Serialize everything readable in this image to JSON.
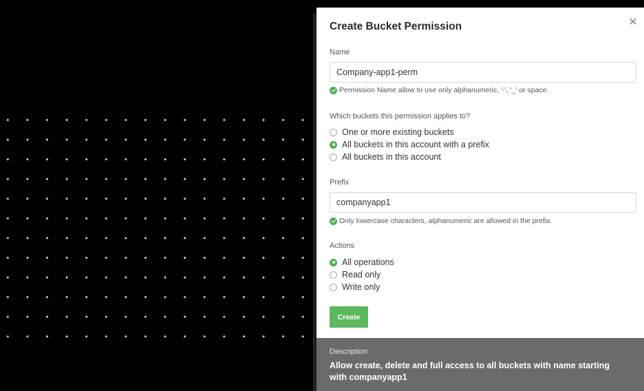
{
  "modal": {
    "title": "Create Bucket Permission",
    "close_icon": "close-icon",
    "name_label": "Name",
    "name_value": "Company-app1-perm",
    "name_hint": "Permission Name allow to use only alphanumeric, '-', '_' or space.",
    "buckets_label": "Which buckets this permission applies to?",
    "bucket_options": [
      {
        "label": "One or more existing buckets",
        "selected": false
      },
      {
        "label": "All buckets in this account with a prefix",
        "selected": true
      },
      {
        "label": "All buckets in this account",
        "selected": false
      }
    ],
    "prefix_label": "Prefix",
    "prefix_value": "companyapp1",
    "prefix_hint": "Only lowercase characters, alphanumeric are allowed in the prefix.",
    "actions_label": "Actions",
    "action_options": [
      {
        "label": "All operations",
        "selected": true
      },
      {
        "label": "Read only",
        "selected": false
      },
      {
        "label": "Write only",
        "selected": false
      }
    ],
    "create_label": "Create",
    "description_label": "Description",
    "description_text": "Allow create, delete and full access to all buckets with name starting with companyapp1"
  },
  "colors": {
    "accent": "#5cb85c",
    "success": "#4caf50",
    "description_bg": "#6b6b6b",
    "backdrop": "#000000",
    "dots": "#bfe8a8"
  }
}
